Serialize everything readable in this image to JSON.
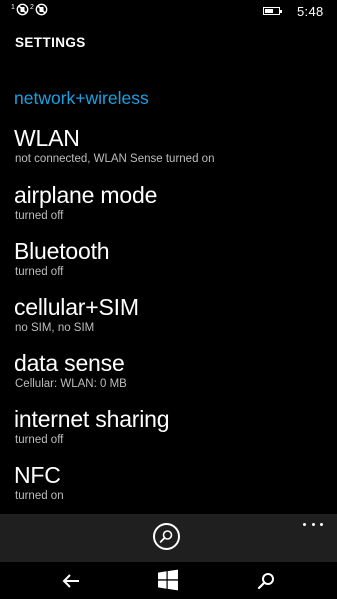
{
  "status_bar": {
    "sim1_label": "1",
    "sim2_label": "2",
    "time": "5:48",
    "battery_level": 0.65
  },
  "header": {
    "app_title": "SETTINGS",
    "pivot": "network+wireless"
  },
  "items": [
    {
      "title": "WLAN",
      "subtitle": "not connected, WLAN Sense turned on"
    },
    {
      "title": "airplane mode",
      "subtitle": "turned off"
    },
    {
      "title": "Bluetooth",
      "subtitle": "turned off"
    },
    {
      "title": "cellular+SIM",
      "subtitle": "no SIM, no SIM"
    },
    {
      "title": "data sense",
      "subtitle": "Cellular:  WLAN: 0 MB"
    },
    {
      "title": "internet sharing",
      "subtitle": "turned off"
    },
    {
      "title": "NFC",
      "subtitle": "turned on"
    }
  ],
  "app_bar": {
    "primary_icon": "search-icon",
    "more_icon": "more-dots-icon"
  },
  "nav_bar": {
    "back_icon": "back-arrow-icon",
    "start_icon": "windows-logo-icon",
    "search_icon": "search-icon"
  },
  "colors": {
    "accent": "#1ba1e2",
    "background": "#000000",
    "app_bar": "#1f1f1f",
    "subtitle": "#bdbdbd"
  }
}
